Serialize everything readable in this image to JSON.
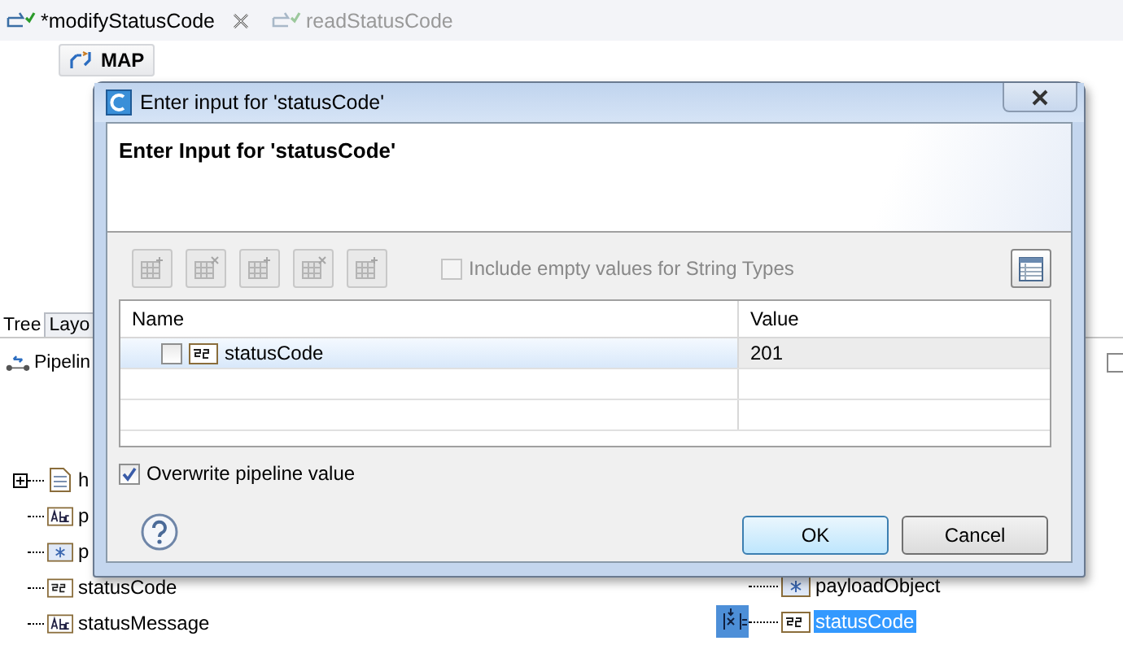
{
  "editor_tabs": [
    {
      "label": "*modifyStatusCode",
      "selected": true,
      "closable": true
    },
    {
      "label": "readStatusCode",
      "selected": false,
      "closable": false
    }
  ],
  "map_button": {
    "label": "MAP"
  },
  "view_tabs": [
    {
      "label": "Tree",
      "selected": true
    },
    {
      "label": "Layo",
      "selected": false
    }
  ],
  "pipeline_tab": {
    "label": "Pipelin"
  },
  "left_tree": [
    {
      "label": "h",
      "kind": "document"
    },
    {
      "label": "p",
      "kind": "string"
    },
    {
      "label": "p",
      "kind": "object"
    },
    {
      "label": "statusCode",
      "kind": "integer"
    },
    {
      "label": "statusMessage",
      "kind": "string"
    }
  ],
  "right_tree": [
    {
      "label": "payloadObject",
      "kind": "object",
      "selected": false
    },
    {
      "label": "statusCode",
      "kind": "integer",
      "selected": true
    }
  ],
  "dialog": {
    "title": "Enter input for 'statusCode'",
    "heading": "Enter Input for 'statusCode'",
    "include_empty": {
      "label": "Include empty values for String Types",
      "checked": false,
      "disabled": true
    },
    "table": {
      "columns": [
        "Name",
        "Value"
      ],
      "rows": [
        {
          "name": "statusCode",
          "kind": "integer",
          "checked": false,
          "value": "201",
          "selected": true
        }
      ]
    },
    "overwrite": {
      "label": "Overwrite pipeline value",
      "checked": true
    },
    "buttons": [
      {
        "label": "OK",
        "default": true
      },
      {
        "label": "Cancel",
        "default": false
      }
    ]
  }
}
